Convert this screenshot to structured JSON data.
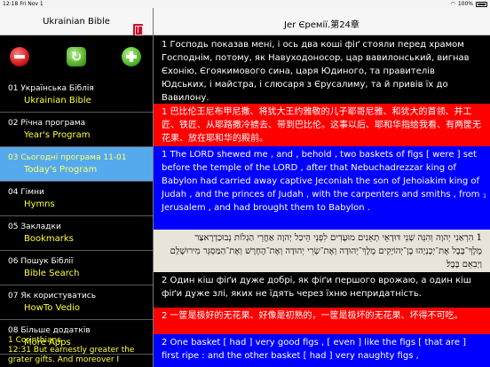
{
  "status_bar": {
    "time": "12:18",
    "date": "Fri Nov 1",
    "battery": "100%"
  },
  "left_nav": {
    "title": "Ukrainian Bible"
  },
  "right_nav": {
    "title": "Jer Єремії.第24章"
  },
  "menu": [
    {
      "line1": "01 Українська Біблія",
      "line2": "Ukrainian Bible"
    },
    {
      "line1": "02 Річна програма",
      "line2": "Year's Program"
    },
    {
      "line1": "03 Сьогодні програма  11-01",
      "line2": "Today's Program",
      "active": true
    },
    {
      "line1": "04 Гімни",
      "line2": "Hymns"
    },
    {
      "line1": "05 Закладки",
      "line2": "Bookmarks"
    },
    {
      "line1": "06 Пошук Біблії",
      "line2": "Bible Search"
    },
    {
      "line1": "07 Як користуватись",
      "line2": "HowTo Vedio"
    },
    {
      "line1": "08 Більше додатків",
      "line2": "More Apps"
    }
  ],
  "side_verse": {
    "ref": "1 Corinthians",
    "text": "12:31 But earnestly greater the grater gifts. And moreover I"
  },
  "verses": [
    {
      "text": "1 Господь показав мені, і ось два коші фіґ стояли перед храмом Господнім, потому, як Навуходоносор, цар вавилонський, вигнав Єхонію, Єгоякимового сина, царя Юдиного, та правителів Юдських, і майстра, і слюсаря з Єрусалиму, та й привів їх до Вавилону."
    },
    {
      "text": "1 巴比伦王尼布甲尼撒、将犹大王约雅敬的儿子耶哥尼雅、和犹大的首领、并工匠、铁匠、从耶路撒冷掳去、带到巴比伦。这事以后、耶和华指给我看、有两筐无花果、放在耶和华的殿前。"
    },
    {
      "text": "1 The LORD shewed me , and , behold , two baskets of figs [ were ] set before the temple of the LORD , after that Nebuchadrezzar king of Babylon had carried away captive Jeconiah the son of Jehoiakim king of Judah , and the princes of Judah , with the carpenters and smiths , from Jerusalem , and had brought them to Babylon ."
    },
    {
      "text": "1 הִרְאַנִי יְהוָה וְהִנֵּה שְׁנֵי דּוּדָאֵי תְאֵנִים מוּעָדִים לִפְנֵי הֵיכַל יְהוָה אַחֲרֵי הַגְלוֹת נְבוּכַדְרֶאצַּר מֶלֶךְ־בָּבֶל אֶת־יְכָנְיָהוּ בֶן־יְהוֹיָקִים מֶלֶךְ־יְהוּדָה וְאֶת־שָׂרֵי יְהוּדָה וְאֶת־הֶחָרָשׁ וְאֶת־הַמַּסְגֵּר מִירוּשָׁלִַם וַיְבִאֵם בָּבֶל׃"
    },
    {
      "text": "2 Один кіш фіґи дуже добрі, як фіґи першого врожаю, а один кіш фіґи дуже злі, яких не їдять через їхню непридатність."
    },
    {
      "text": "2 一筐是极好的无花果、好像是初熟的，一筐是极坏的无花果、坏得不可吃。"
    },
    {
      "text": "2 One basket [ had ] very good figs , [ even ] like the figs [ that are ] first ripe : and the other basket [ had ] very naughty figs ,"
    }
  ],
  "markers": {
    "ctrl": "1",
    "hebrew": "1"
  }
}
